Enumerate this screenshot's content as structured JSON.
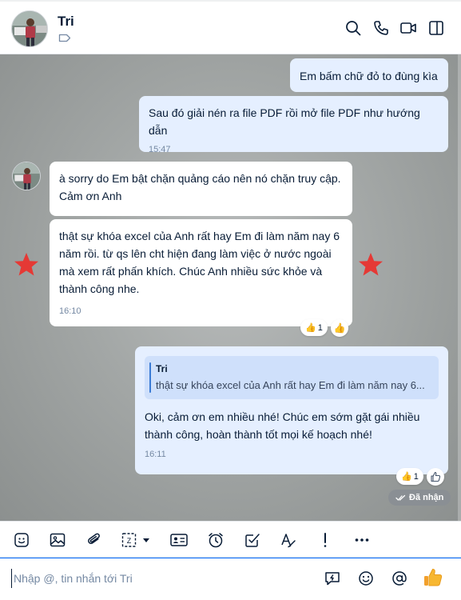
{
  "header": {
    "contact_name": "Tri",
    "icons": [
      "search-icon",
      "phone-icon",
      "video-call-icon",
      "sidebar-toggle-icon"
    ]
  },
  "messages": [
    {
      "id": "m1",
      "direction": "out",
      "text": "Em bấm chữ đỏ to đùng kìa"
    },
    {
      "id": "m2",
      "direction": "out",
      "text": "Sau đó giải nén ra file PDF rồi mở file PDF như hướng dẫn",
      "time": "15:47"
    },
    {
      "id": "m3",
      "direction": "in",
      "text": "à sorry do Em bật chặn quảng cáo nên nó chặn truy cập. Cảm ơn Anh"
    },
    {
      "id": "m4",
      "direction": "in",
      "text": "thật sự khóa excel của Anh rất hay Em đi làm năm nay 6 năm rồi. từ qs lên cht hiện đang làm việc ở nước ngoài mà xem rất phấn khích. Chúc Anh nhiều sức khỏe và thành công nhe.",
      "time": "16:10",
      "reaction_count": "1"
    },
    {
      "id": "m5",
      "direction": "out",
      "quote": {
        "name": "Tri",
        "text": "thật sự khóa excel của Anh rất hay Em đi làm năm nay 6..."
      },
      "text": "Oki, cảm ơn em nhiều nhé! Chúc em sớm gặt gái nhiều thành công, hoàn thành tốt mọi kế hoạch nhé!",
      "time": "16:11",
      "reaction_count": "1",
      "status": "Đã nhận"
    }
  ],
  "toolbar": {
    "icons": [
      "sticker-icon",
      "image-icon",
      "attachment-icon",
      "screenshot-icon",
      "contact-card-icon",
      "reminder-clock-icon",
      "task-check-icon",
      "text-format-icon",
      "urgent-exclamation-icon",
      "more-icon"
    ]
  },
  "composer": {
    "placeholder": "Nhập @, tin nhắn tới Tri",
    "icons": [
      "quick-message-icon",
      "emoji-icon",
      "mention-icon",
      "thumbs-up-send-icon"
    ]
  },
  "colors": {
    "accent": "#0068ff",
    "my_bubble": "#e5efff",
    "their_bubble": "#ffffff",
    "timestamp": "#7589a3",
    "star": "#e53935"
  }
}
